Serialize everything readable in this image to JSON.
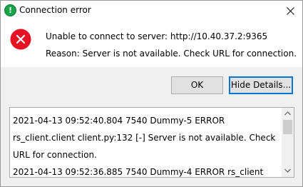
{
  "window": {
    "title": "Connection error",
    "app_icon_glyph": "!",
    "close_icon": "close-icon"
  },
  "message": {
    "icon": "error-icon",
    "line1": "Unable to connect to server: http://10.40.37.2:9365",
    "line2": "Reason: Server is not available. Check URL for connection."
  },
  "buttons": {
    "ok_label": "OK",
    "hide_details_label": "Hide Details..."
  },
  "details": {
    "text": "2021-04-13 09:52:40.804 7540 Dummy-5 ERROR\nrs_client.client client.py:132 [-] Server is not available. Check\nURL for connection.\n2021-04-13 09:52:36.885 7540 Dummy-4 ERROR rs_client"
  },
  "colors": {
    "error_red": "#e81123",
    "app_icon_green": "#19a34a",
    "focus_blue": "#0078d7",
    "button_face": "#e1e1e1",
    "dialog_background": "#f0f0f0"
  }
}
